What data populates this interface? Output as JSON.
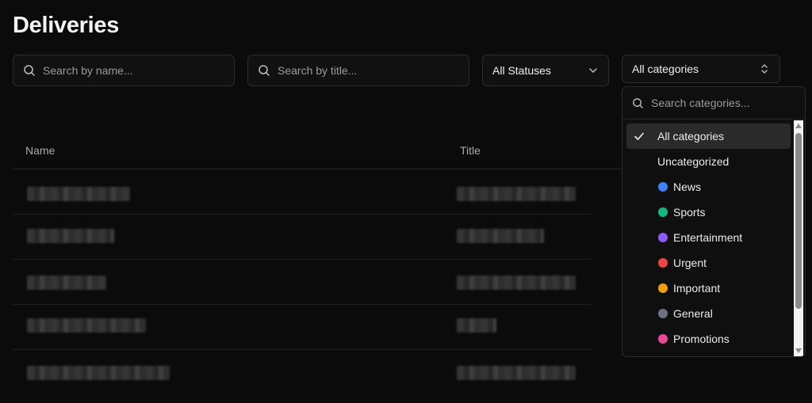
{
  "page": {
    "title": "Deliveries"
  },
  "filters": {
    "name_search": {
      "placeholder": "Search by name..."
    },
    "title_search": {
      "placeholder": "Search by title..."
    },
    "status_select": {
      "value": "All Statuses"
    },
    "category_select": {
      "value": "All categories"
    }
  },
  "table": {
    "columns": [
      "Name",
      "Title"
    ]
  },
  "category_dropdown": {
    "search_placeholder": "Search categories...",
    "options": [
      {
        "label": "All categories",
        "selected": true,
        "color": null
      },
      {
        "label": "Uncategorized",
        "selected": false,
        "color": null
      },
      {
        "label": "News",
        "selected": false,
        "color": "#3b82f6"
      },
      {
        "label": "Sports",
        "selected": false,
        "color": "#10b981"
      },
      {
        "label": "Entertainment",
        "selected": false,
        "color": "#8b5cf6"
      },
      {
        "label": "Urgent",
        "selected": false,
        "color": "#ef4444"
      },
      {
        "label": "Important",
        "selected": false,
        "color": "#f59e0b"
      },
      {
        "label": "General",
        "selected": false,
        "color": "#6b7280"
      },
      {
        "label": "Promotions",
        "selected": false,
        "color": "#ec4899"
      }
    ]
  }
}
